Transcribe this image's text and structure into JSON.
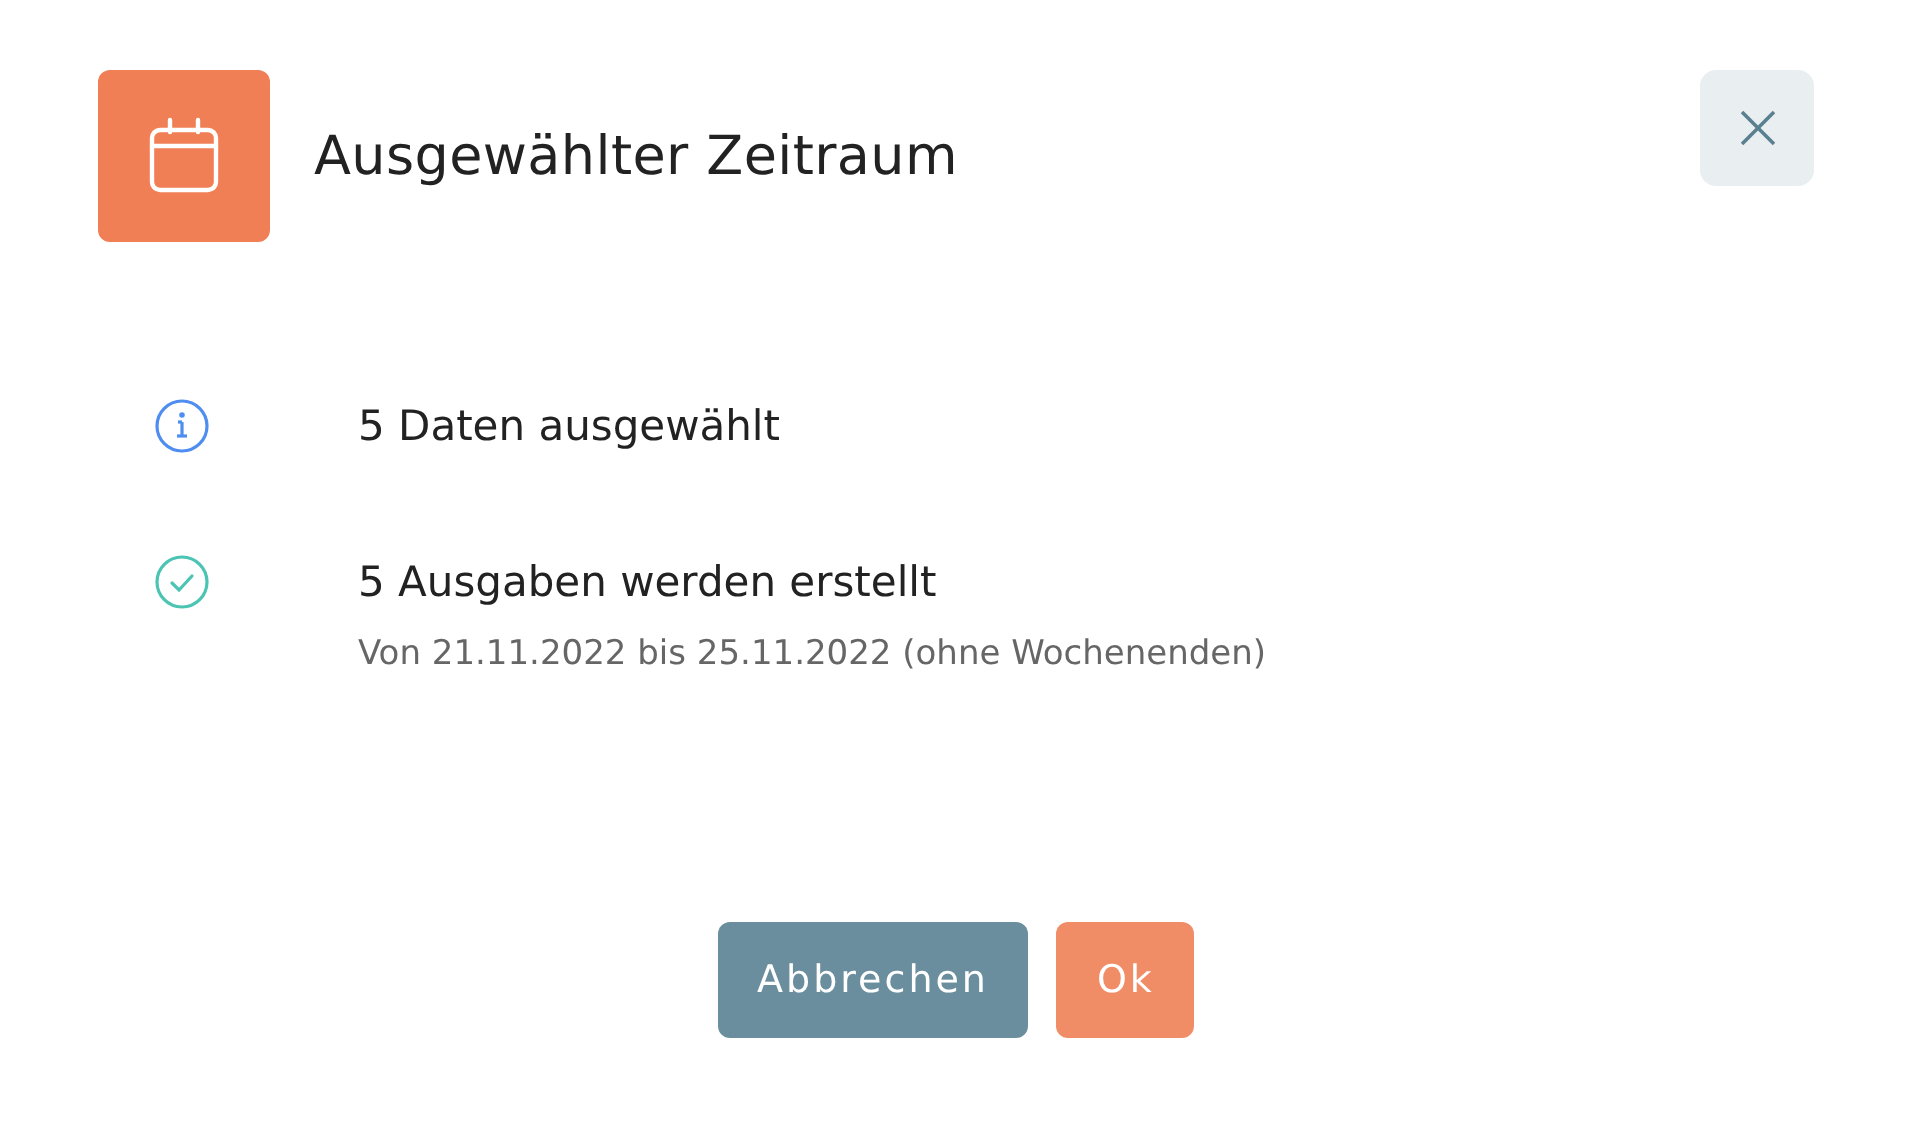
{
  "dialog": {
    "title": "Ausgewählter Zeitraum"
  },
  "items": [
    {
      "kind": "info",
      "text": "5 Daten ausgewählt"
    },
    {
      "kind": "success",
      "text": "5 Ausgaben werden erstellt",
      "detail": "Von 21.11.2022 bis 25.11.2022 (ohne Wochenenden)"
    }
  ],
  "buttons": [
    {
      "kind": "secondary",
      "label": "Abbrechen"
    },
    {
      "kind": "primary",
      "label": "Ok"
    }
  ]
}
